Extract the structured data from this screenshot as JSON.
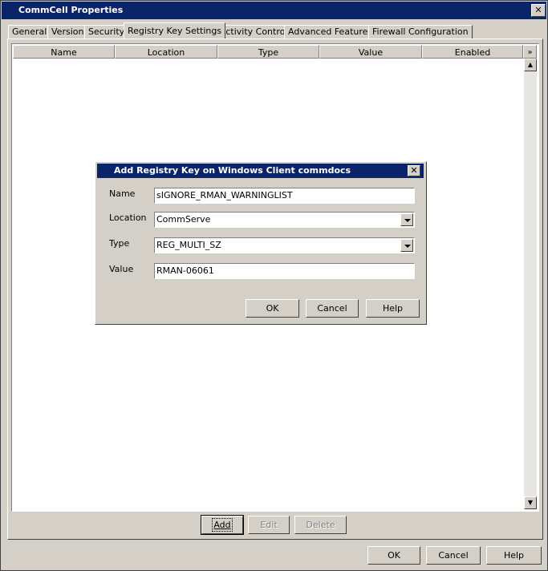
{
  "window": {
    "title": "CommCell Properties"
  },
  "tabs": [
    {
      "label": "General"
    },
    {
      "label": "Version"
    },
    {
      "label": "Security"
    },
    {
      "label": "Registry Key Settings"
    },
    {
      "label": "Activity Control"
    },
    {
      "label": "Advanced Features"
    },
    {
      "label": "Firewall Configuration"
    }
  ],
  "table": {
    "columns": [
      "Name",
      "Location",
      "Type",
      "Value",
      "Enabled"
    ],
    "more_columns_icon": "chevron-double-down"
  },
  "panel_buttons": {
    "add": "Add",
    "edit": "Edit",
    "delete": "Delete"
  },
  "footer_buttons": {
    "ok": "OK",
    "cancel": "Cancel",
    "help": "Help"
  },
  "dialog": {
    "title": "Add Registry Key on Windows Client  commdocs",
    "name_label": "Name",
    "name_value": "sIGNORE_RMAN_WARNINGLIST",
    "location_label": "Location",
    "location_value": "CommServe",
    "type_label": "Type",
    "type_value": "REG_MULTI_SZ",
    "value_label": "Value",
    "value_value": "RMAN-06061",
    "ok": "OK",
    "cancel": "Cancel",
    "help": "Help"
  }
}
